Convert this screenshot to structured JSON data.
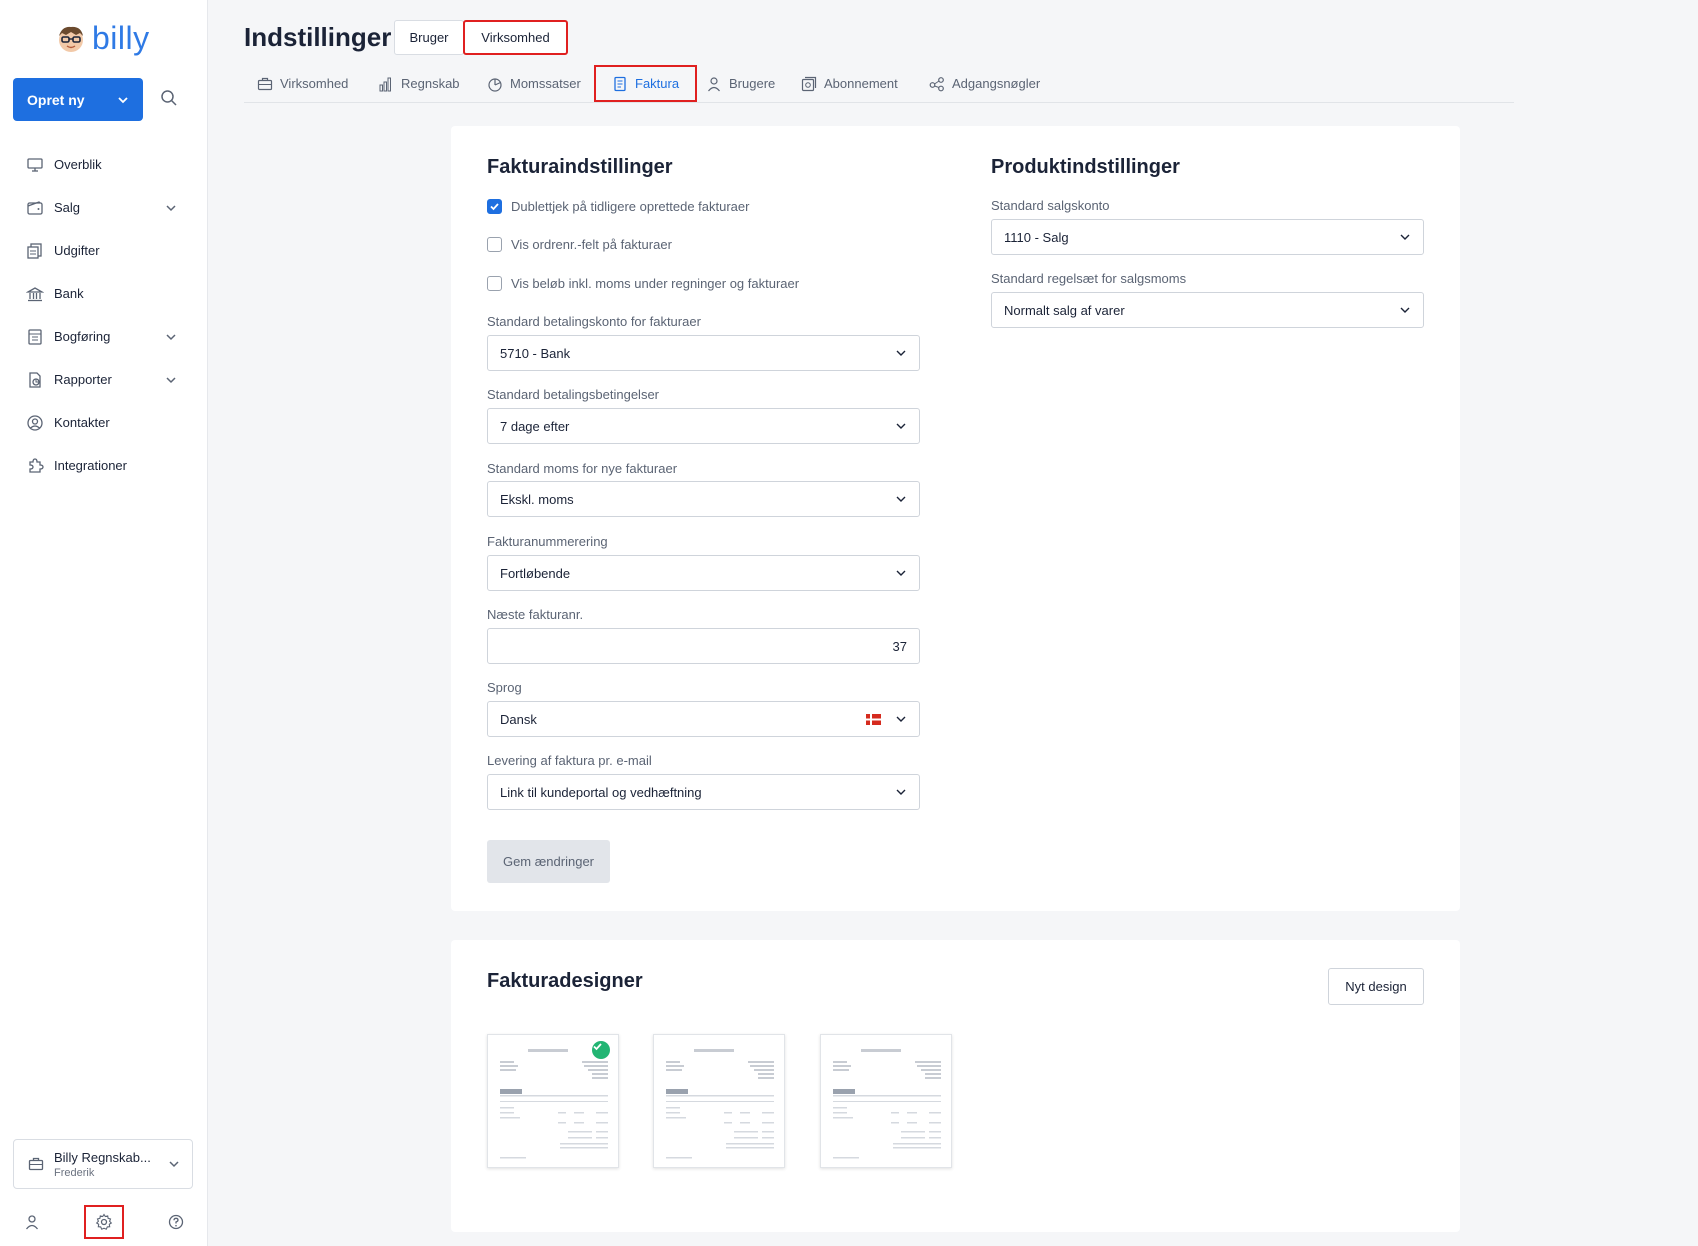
{
  "app": {
    "logo_text": "billy"
  },
  "sidebar": {
    "create_label": "Opret ny",
    "items": [
      {
        "label": "Overblik",
        "icon": "monitor-icon",
        "expandable": false
      },
      {
        "label": "Salg",
        "icon": "wallet-icon",
        "expandable": true
      },
      {
        "label": "Udgifter",
        "icon": "receipts-icon",
        "expandable": false
      },
      {
        "label": "Bank",
        "icon": "bank-icon",
        "expandable": false
      },
      {
        "label": "Bogføring",
        "icon": "ledger-icon",
        "expandable": true
      },
      {
        "label": "Rapporter",
        "icon": "report-icon",
        "expandable": true
      },
      {
        "label": "Kontakter",
        "icon": "contact-icon",
        "expandable": false
      },
      {
        "label": "Integrationer",
        "icon": "puzzle-icon",
        "expandable": false
      }
    ],
    "company": {
      "name": "Billy Regnskab...",
      "user": "Frederik"
    }
  },
  "header": {
    "title": "Indstillinger",
    "segments": [
      "Bruger",
      "Virksomhed"
    ],
    "active_segment": "Virksomhed"
  },
  "tabs": [
    {
      "label": "Virksomhed",
      "icon": "briefcase-icon"
    },
    {
      "label": "Regnskab",
      "icon": "bar-chart-icon"
    },
    {
      "label": "Momssatser",
      "icon": "pie-chart-icon"
    },
    {
      "label": "Faktura",
      "icon": "invoice-icon"
    },
    {
      "label": "Brugere",
      "icon": "user-icon"
    },
    {
      "label": "Abonnement",
      "icon": "subscription-icon"
    },
    {
      "label": "Adgangsnøgler",
      "icon": "key-share-icon"
    }
  ],
  "active_tab": "Faktura",
  "invoice_settings": {
    "title": "Fakturaindstillinger",
    "checkboxes": [
      {
        "label": "Dublettjek på tidligere oprettede fakturaer",
        "checked": true
      },
      {
        "label": "Vis ordrenr.-felt på fakturaer",
        "checked": false
      },
      {
        "label": "Vis beløb inkl. moms under regninger og fakturaer",
        "checked": false
      }
    ],
    "fields": {
      "payment_account": {
        "label": "Standard betalingskonto for fakturaer",
        "value": "5710 - Bank"
      },
      "payment_terms": {
        "label": "Standard betalingsbetingelser",
        "value": "7 dage efter"
      },
      "vat": {
        "label": "Standard moms for nye fakturaer",
        "value": "Ekskl. moms"
      },
      "numbering": {
        "label": "Fakturanummerering",
        "value": "Fortløbende"
      },
      "next_number": {
        "label": "Næste fakturanr.",
        "value": "37"
      },
      "language": {
        "label": "Sprog",
        "value": "Dansk"
      },
      "delivery": {
        "label": "Levering af faktura pr. e-mail",
        "value": "Link til kundeportal og vedhæftning"
      }
    },
    "save_label": "Gem ændringer"
  },
  "product_settings": {
    "title": "Produktindstillinger",
    "fields": {
      "sales_account": {
        "label": "Standard salgskonto",
        "value": "1110 - Salg"
      },
      "vat_rules": {
        "label": "Standard regelsæt for salgsmoms",
        "value": "Normalt salg af varer"
      }
    }
  },
  "designs": {
    "title": "Fakturadesigner",
    "new_label": "Nyt design",
    "thumbnails": [
      {
        "active": true
      },
      {
        "active": false
      },
      {
        "active": false
      }
    ]
  },
  "colors": {
    "accent": "#1e6fe0",
    "highlight": "#e02020",
    "success": "#22b573"
  }
}
